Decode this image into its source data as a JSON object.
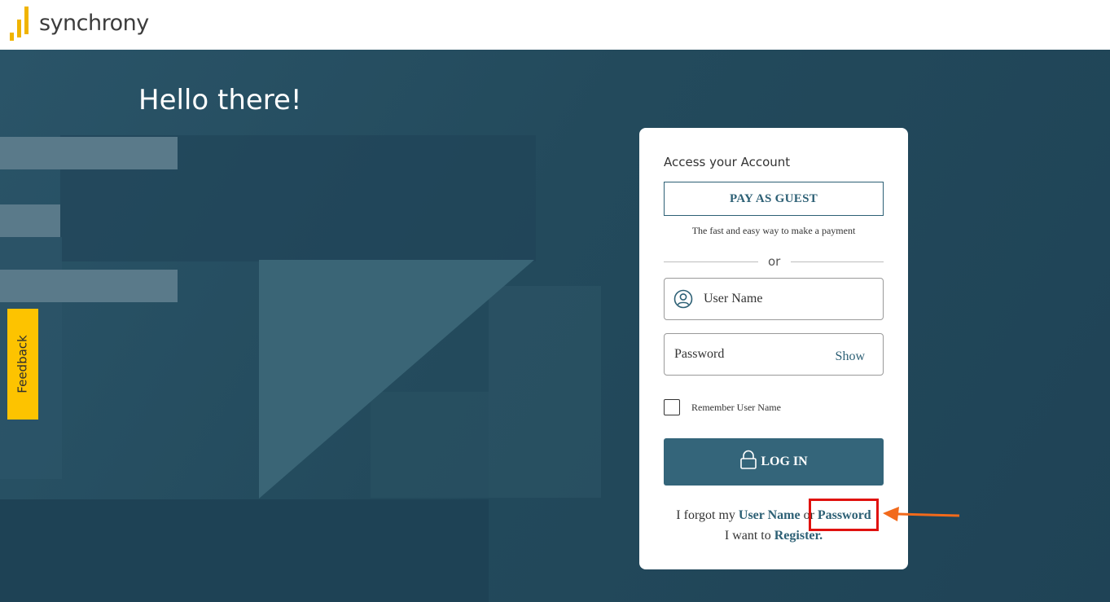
{
  "brand": {
    "name": "synchrony",
    "bar_color": "#f0b400"
  },
  "hero": {
    "greeting": "Hello there!"
  },
  "feedback": {
    "label": "Feedback",
    "color": "#fdc300"
  },
  "login_card": {
    "title": "Access your Account",
    "guest_button": "PAY AS GUEST",
    "guest_subtitle": "The fast and easy way to make a payment",
    "divider_text": "or",
    "username_placeholder": "User Name",
    "password_placeholder": "Password",
    "show_label": "Show",
    "remember_label": "Remember User Name",
    "login_button": "LOG IN",
    "forgot_prefix": "I forgot my",
    "forgot_username": "User Name",
    "forgot_or": "or",
    "forgot_password": "Password",
    "register_prefix": "I want to",
    "register_link": "Register."
  },
  "icons": {
    "user": "user-circle-icon",
    "lock": "lock-icon",
    "arrow": "arrow-left-icon"
  },
  "colors": {
    "accent": "#2d6075",
    "login_button": "#34657a",
    "hero_bg": "#234a5c",
    "annotation_box": "#e0120f",
    "annotation_arrow": "#f26a1b"
  }
}
